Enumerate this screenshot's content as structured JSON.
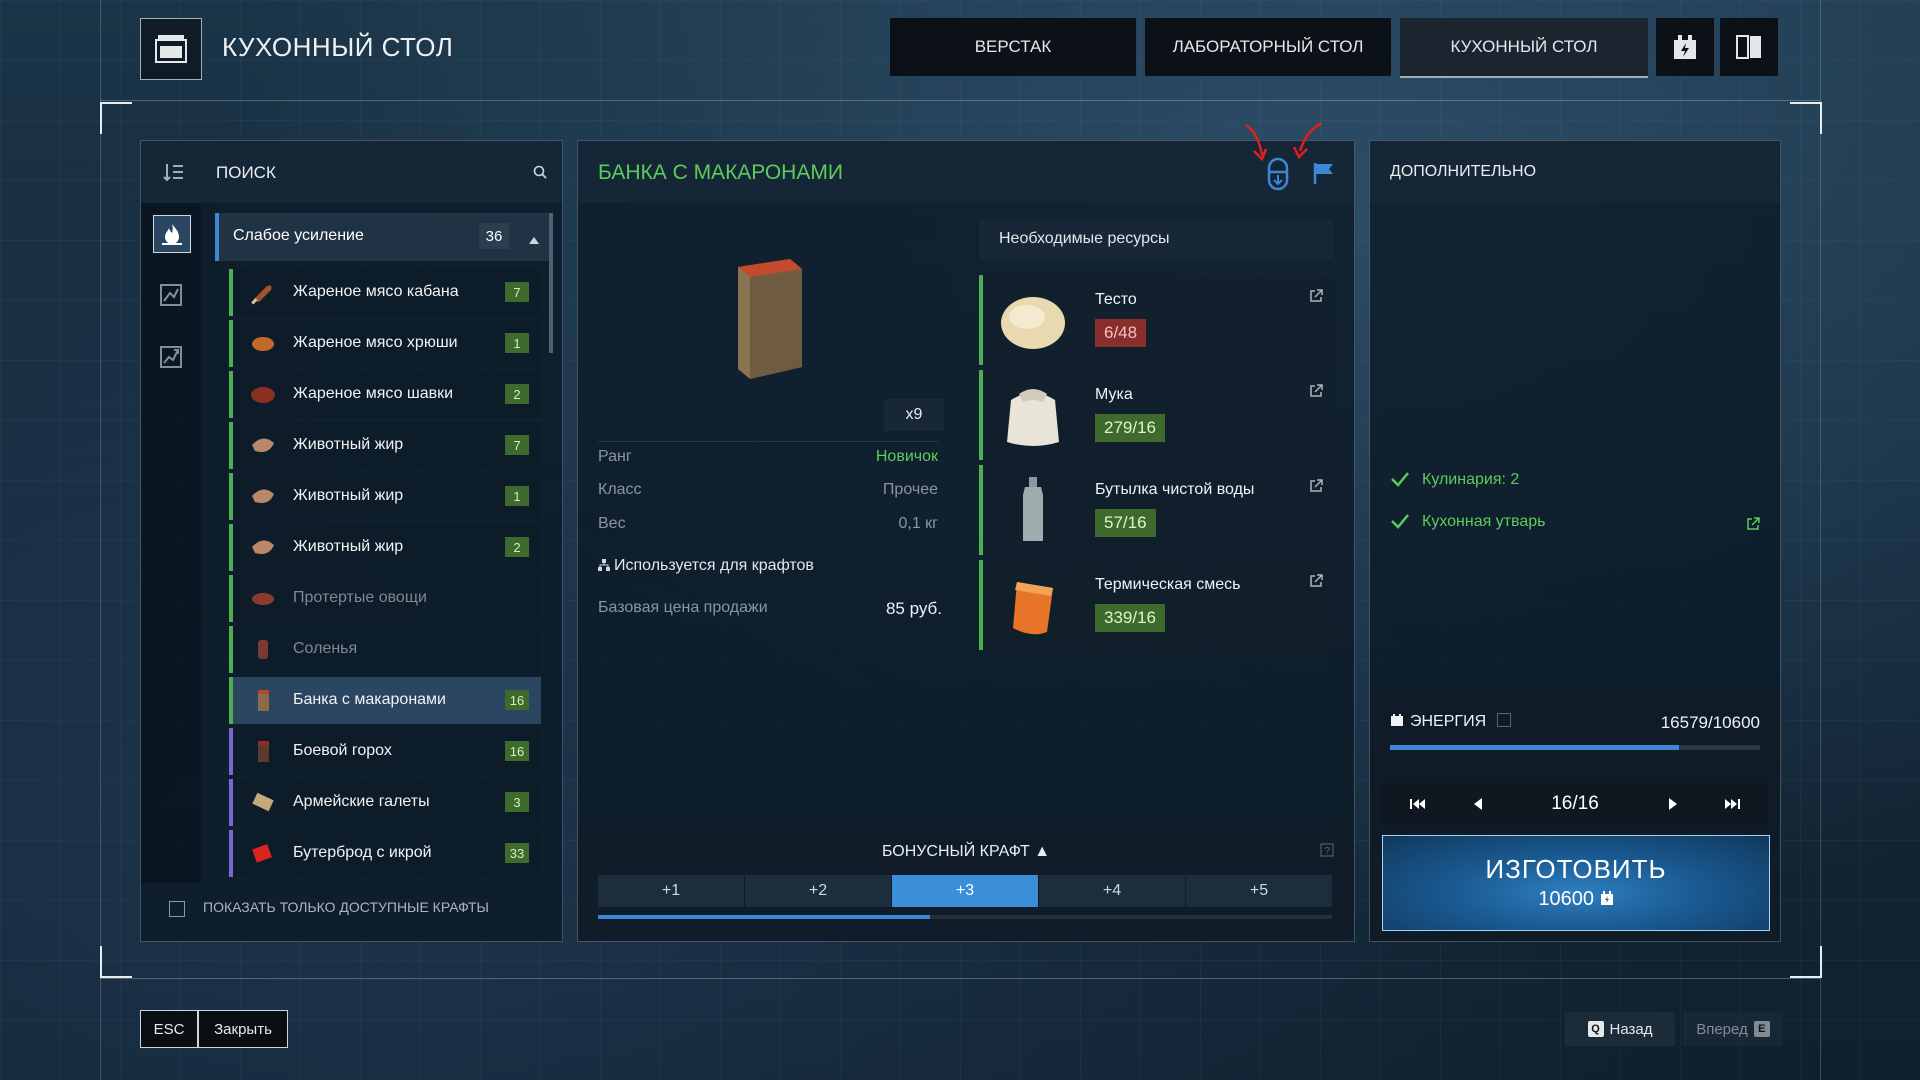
{
  "header": {
    "station_title": "КУХОННЫЙ СТОЛ",
    "tabs": [
      {
        "label": "ВЕРСТАК"
      },
      {
        "label": "ЛАБОРАТОРНЫЙ СТОЛ"
      },
      {
        "label": "КУХОННЫЙ СТОЛ"
      }
    ],
    "icons": [
      "energy-pack-icon",
      "book-icon"
    ]
  },
  "left": {
    "search_label": "ПОИСК",
    "group": {
      "label": "Слабое усиление",
      "count": "36"
    },
    "items": [
      {
        "name": "Жареное мясо кабана",
        "count": "7"
      },
      {
        "name": "Жареное мясо хрюши",
        "count": "1"
      },
      {
        "name": "Жареное мясо шавки",
        "count": "2"
      },
      {
        "name": "Животный жир",
        "count": "7"
      },
      {
        "name": "Животный жир",
        "count": "1"
      },
      {
        "name": "Животный жир",
        "count": "2"
      },
      {
        "name": "Протертые овощи",
        "count": ""
      },
      {
        "name": "Соленья",
        "count": ""
      },
      {
        "name": "Банка с макаронами",
        "count": "16"
      },
      {
        "name": "Боевой горох",
        "count": "16"
      },
      {
        "name": "Армейские галеты",
        "count": "3"
      },
      {
        "name": "Бутерброд с икрой",
        "count": "33"
      }
    ],
    "show_available_label": "ПОКАЗАТЬ ТОЛЬКО ДОСТУПНЫЕ КРАФТЫ"
  },
  "middle": {
    "title": "БАНКА С МАКАРОНАМИ",
    "multiplier": "x9",
    "stats": [
      {
        "key": "Ранг",
        "value": "Новичок"
      },
      {
        "key": "Класс",
        "value": "Прочее"
      },
      {
        "key": "Вес",
        "value": "0,1 кг"
      }
    ],
    "used_for": "Используется для крафтов",
    "price_key": "Базовая цена продажи",
    "price_value": "85 руб.",
    "resources_header": "Необходимые ресурсы",
    "resources": [
      {
        "name": "Тесто",
        "qty": "6/48",
        "status": "bad"
      },
      {
        "name": "Мука",
        "qty": "279/16",
        "status": "ok"
      },
      {
        "name": "Бутылка чистой воды",
        "qty": "57/16",
        "status": "ok"
      },
      {
        "name": "Термическая смесь",
        "qty": "339/16",
        "status": "ok"
      }
    ],
    "bonus": {
      "title": "БОНУСНЫЙ КРАФТ",
      "tabs": [
        "+1",
        "+2",
        "+3",
        "+4",
        "+5"
      ],
      "selected_index": 2
    }
  },
  "right": {
    "title": "ДОПОЛНИТЕЛЬНО",
    "requirements": [
      "Кулинария: 2",
      "Кухонная утварь"
    ],
    "energy_label": "ЭНЕРГИЯ",
    "energy_value": "16579/10600",
    "energy_fill": 0.78,
    "pager_value": "16/16",
    "craft_label": "ИЗГОТОВИТЬ",
    "craft_cost": "10600"
  },
  "footer": {
    "esc_key": "ESC",
    "close_label": "Закрыть",
    "back_key": "Q",
    "back_label": "Назад",
    "forward_label": "Вперед",
    "forward_key": "E"
  },
  "colors": {
    "accent_blue": "#3c88d6",
    "accent_green": "#5ccc5a",
    "bad_red": "#8a2d2d",
    "annotation_red": "#e02020"
  }
}
